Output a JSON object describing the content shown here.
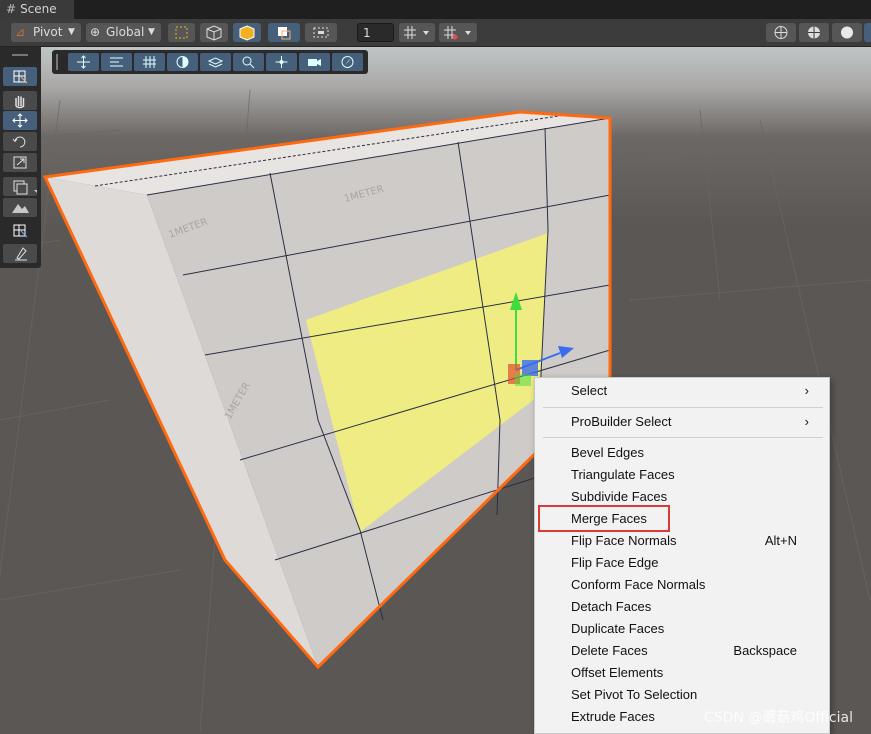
{
  "tab": {
    "title": "Scene",
    "icon": "grid-icon"
  },
  "toolbar": {
    "pivot_label": "Pivot",
    "global_label": "Global",
    "grid_value": "1"
  },
  "context_menu": {
    "items": [
      {
        "label": "Select",
        "submenu": true,
        "shortcut": ""
      },
      {
        "label": "ProBuilder Select",
        "submenu": true,
        "shortcut": ""
      },
      {
        "label": "Bevel Edges",
        "shortcut": ""
      },
      {
        "label": "Triangulate Faces",
        "shortcut": ""
      },
      {
        "label": "Subdivide Faces",
        "shortcut": ""
      },
      {
        "label": "Merge Faces",
        "shortcut": "",
        "highlighted": true
      },
      {
        "label": "Flip Face Normals",
        "shortcut": "Alt+N"
      },
      {
        "label": "Flip Face Edge",
        "shortcut": ""
      },
      {
        "label": "Conform Face Normals",
        "shortcut": ""
      },
      {
        "label": "Detach Faces",
        "shortcut": ""
      },
      {
        "label": "Duplicate Faces",
        "shortcut": ""
      },
      {
        "label": "Delete Faces",
        "shortcut": "Backspace"
      },
      {
        "label": "Offset Elements",
        "shortcut": ""
      },
      {
        "label": "Set Pivot To Selection",
        "shortcut": ""
      },
      {
        "label": "Extrude Faces",
        "shortcut": ""
      }
    ],
    "arrow_glyph": "›"
  },
  "mesh_texture_label": "1METER",
  "watermark": "CSDN @蘑菇鸡Official",
  "colors": {
    "selection_outline": "#ff6a10",
    "selected_face": "#f1f07a",
    "gizmo_y": "#3fdc3f",
    "gizmo_x": "#e05030",
    "gizmo_z": "#3a6cf0",
    "highlight_box": "#d93a3a",
    "active_button": "#46607c"
  }
}
